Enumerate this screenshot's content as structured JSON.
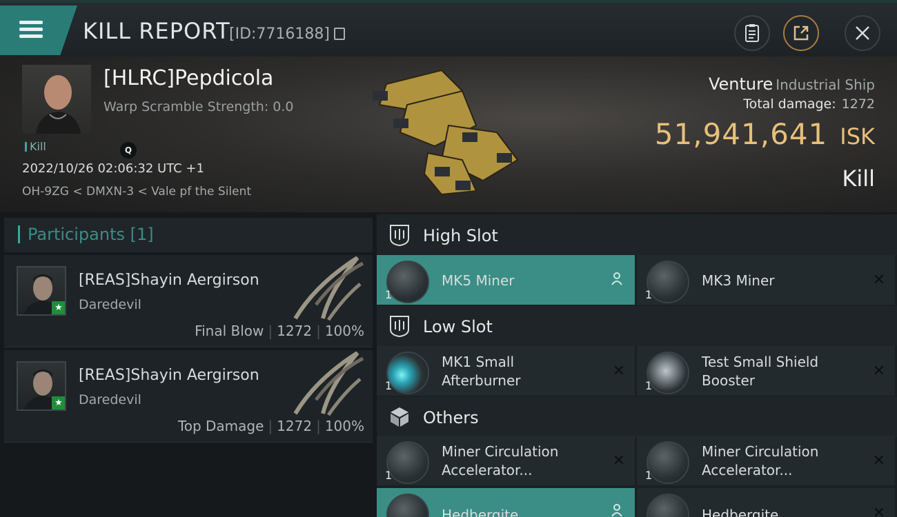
{
  "header": {
    "title": "KILL REPORT",
    "report_id": "[ID:7716188]"
  },
  "victim": {
    "name": "[HLRC]Pepdicola",
    "warp_scramble": "Warp Scramble Strength: 0.0",
    "kill_tag": "Kill",
    "q_badge": "Q",
    "datetime": "2022/10/26 02:06:32 UTC +1",
    "location": "OH-9ZG < DMXN-3 < Vale pf the Silent",
    "ship_name": "Venture",
    "ship_class": "Industrial Ship",
    "total_damage_label": "Total damage:",
    "total_damage": "1272",
    "isk_value": "51,941,641",
    "isk_unit": "ISK",
    "outcome": "Kill"
  },
  "participants": {
    "label": "Participants [1]",
    "rows": [
      {
        "name": "[REAS]Shayin Aergirson",
        "ship": "Daredevil",
        "role": "Final Blow",
        "damage": "1272",
        "percent": "100%"
      },
      {
        "name": "[REAS]Shayin Aergirson",
        "ship": "Daredevil",
        "role": "Top Damage",
        "damage": "1272",
        "percent": "100%"
      }
    ]
  },
  "slots": {
    "high": {
      "label": "High Slot",
      "items": [
        {
          "line1": "MK5 Miner",
          "line2": "",
          "qty": "1",
          "state": "highlighted"
        },
        {
          "line1": "MK3 Miner",
          "line2": "",
          "qty": "1",
          "state": "destroyed"
        }
      ]
    },
    "low": {
      "label": "Low Slot",
      "items": [
        {
          "line1": "MK1 Small",
          "line2": "Afterburner",
          "qty": "1",
          "state": "destroyed"
        },
        {
          "line1": "Test Small Shield",
          "line2": "Booster",
          "qty": "1",
          "state": "destroyed"
        }
      ]
    },
    "others": {
      "label": "Others",
      "items": [
        {
          "line1": "Miner Circulation",
          "line2": "Accelerator...",
          "qty": "1",
          "state": "destroyed"
        },
        {
          "line1": "Miner Circulation",
          "line2": "Accelerator...",
          "qty": "1",
          "state": "destroyed"
        },
        {
          "line1": "Hedbergite",
          "line2": "",
          "qty": "",
          "state": "highlighted"
        },
        {
          "line1": "Hedbergite",
          "line2": "",
          "qty": "",
          "state": "destroyed"
        }
      ]
    }
  },
  "colors": {
    "accent": "#3a8e85",
    "isk": "#e8c07a",
    "participants_label": "#3c8c86"
  },
  "icons": [
    "menu-icon",
    "copy-icon",
    "clipboard-icon",
    "share-icon",
    "close-icon",
    "high-slot-icon",
    "low-slot-icon",
    "cube-icon",
    "person-icon",
    "remove-icon",
    "star-icon"
  ]
}
